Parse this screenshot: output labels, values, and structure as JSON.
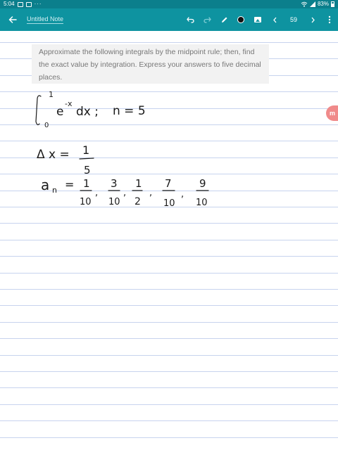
{
  "status_bar": {
    "time": "5:04",
    "more": "···",
    "battery": "83%"
  },
  "toolbar": {
    "back_icon": "back-arrow-icon",
    "title": "Untitled Note",
    "page_number": "59",
    "pen_color": "#111111"
  },
  "prompt": {
    "text": "Approximate the following integrals by the midpoint rule; then, find the exact value by integration. Express your answers to five decimal places."
  },
  "side_tab": {
    "label": "m"
  },
  "handwriting": {
    "integral_lower": "0",
    "integral_upper": "1",
    "integrand_base": "e",
    "integrand_exp": "-x",
    "differential": "dx ;",
    "n_label": "n = 5",
    "dx_label": "Δ x =",
    "dx_num": "1",
    "dx_den": "5",
    "a_label": "a",
    "a_sub": "n",
    "a_eq": "=",
    "fractions": [
      {
        "num": "1",
        "den": "10"
      },
      {
        "num": "3",
        "den": "10"
      },
      {
        "num": "1",
        "den": "2"
      },
      {
        "num": "7",
        "den": "10"
      },
      {
        "num": "9",
        "den": "10"
      }
    ]
  },
  "colors": {
    "toolbar": "#0e93a0",
    "status_bar": "#0b7f8c",
    "rule_line": "#c7d3ee",
    "side_tab": "#f08a8a"
  }
}
